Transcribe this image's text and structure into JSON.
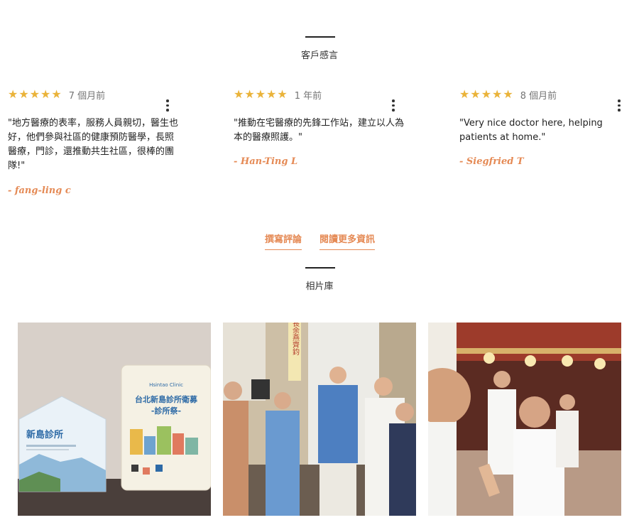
{
  "testimonials": {
    "title": "客戶感言",
    "reviews": [
      {
        "stars": 5,
        "time": "7 個月前",
        "text": "\"地方醫療的表率，服務人員親切，醫生也好，他們參與社區的健康預防醫學，長照醫療，門診，還推動共生社區，很棒的團隊!\"",
        "author": "- fang-ling c"
      },
      {
        "stars": 5,
        "time": "1 年前",
        "text": "\"推動在宅醫療的先鋒工作站，建立以人為本的醫療照護。\"",
        "author": "- Han-Ting L"
      },
      {
        "stars": 5,
        "time": "8 個月前",
        "text": "\"Very nice doctor here, helping patients at home.\"",
        "author": "- Siegfried T"
      }
    ],
    "links": {
      "write_review": "撰寫評論",
      "read_more": "閱讀更多資訊"
    }
  },
  "gallery": {
    "title": "相片庫",
    "photo1": {
      "brand_cn": "新島診所",
      "brand_en": "Hsintao Clinic",
      "book_title": "台北新島診所衛募",
      "book_subtitle": "-診所祭-"
    },
    "photo2": {
      "banner": "所長余燕齊鈞"
    }
  },
  "colors": {
    "accent": "#e58a55",
    "star": "#eab33a",
    "rule": "#222222"
  }
}
